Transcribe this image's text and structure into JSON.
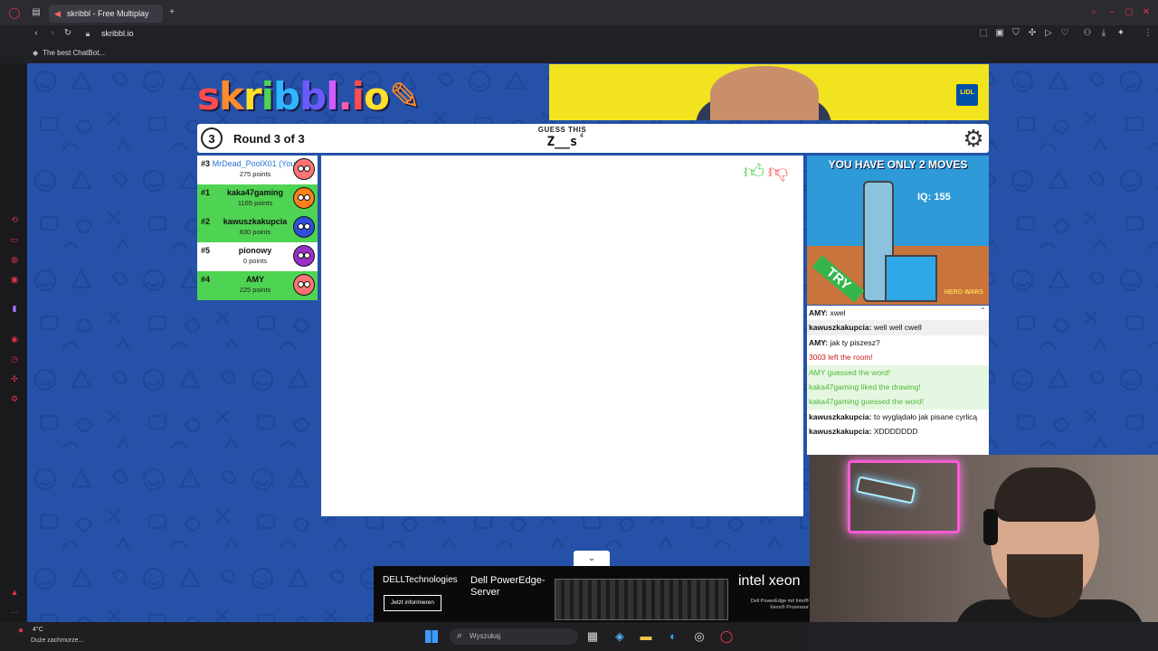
{
  "browser": {
    "tab_title": "skribbl - Free Multiplay",
    "url": "skribbl.io",
    "bookmark": "The best ChatBot..."
  },
  "game": {
    "logo": "skribbl.io",
    "round_number": "3",
    "round_text": "Round 3 of 3",
    "guess_label": "GUESS THIS",
    "word": "Z__s",
    "word_length": "4"
  },
  "players": [
    {
      "rank": "#3",
      "name": "MrDead_PoolX01 (You)",
      "points": "275 points",
      "color": "#ff7373",
      "bg": "#ffffff",
      "me": true
    },
    {
      "rank": "#1",
      "name": "kaka47gaming",
      "points": "1165 points",
      "color": "#ff7f1a",
      "bg": "#4fd353",
      "me": false
    },
    {
      "rank": "#2",
      "name": "kawuszkakupcia",
      "points": "830 points",
      "color": "#2f4fd8",
      "bg": "#4fd353",
      "me": false
    },
    {
      "rank": "#5",
      "name": "pionowy",
      "points": "0 points",
      "color": "#9a2fc9",
      "bg": "#ffffff",
      "me": false
    },
    {
      "rank": "#4",
      "name": "AMY",
      "points": "225 points",
      "color": "#ff7373",
      "bg": "#4fd353",
      "me": false
    }
  ],
  "side_ad": {
    "title": "YOU HAVE ONLY 2 MOVES",
    "iq": "IQ: 155",
    "cta": "TRY",
    "brand": "HERO WARS"
  },
  "chat": [
    {
      "user": "AMY:",
      "text": "xwel",
      "kind": "normal"
    },
    {
      "user": "kawuszkakupcia:",
      "text": "well well cwell",
      "kind": "alt"
    },
    {
      "user": "AMY:",
      "text": "jak ty piszesz?",
      "kind": "normal"
    },
    {
      "user": "",
      "text": "3003 left the room!",
      "kind": "red"
    },
    {
      "user": "",
      "text": "AMY guessed the word!",
      "kind": "green"
    },
    {
      "user": "",
      "text": "kaka47gaming liked the drawing!",
      "kind": "green"
    },
    {
      "user": "",
      "text": "kaka47gaming guessed the word!",
      "kind": "green"
    },
    {
      "user": "kawuszkakupcia:",
      "text": "to wyglądało jak pisane cyrlicą",
      "kind": "two"
    },
    {
      "user": "kawuszkakupcia:",
      "text": "XDDDDDDD",
      "kind": "normal"
    }
  ],
  "bottom_ad": {
    "brand": "DELLTechnologies",
    "button": "Jetzt informieren",
    "product": "Dell PowerEdge-Server",
    "chip": "intel xeon",
    "chip_sub": "Dell PowerEdge mit Intel® Xeon® Prozessor"
  },
  "taskbar": {
    "temperature": "4°C",
    "weather": "Duże zachmurze...",
    "search_placeholder": "Wyszukaj"
  },
  "colors": {
    "page_bg": "#2552a8",
    "player_highlight": "#4fd353",
    "chat_guessed": "#4fb83a",
    "chat_left": "#c61b1b"
  }
}
